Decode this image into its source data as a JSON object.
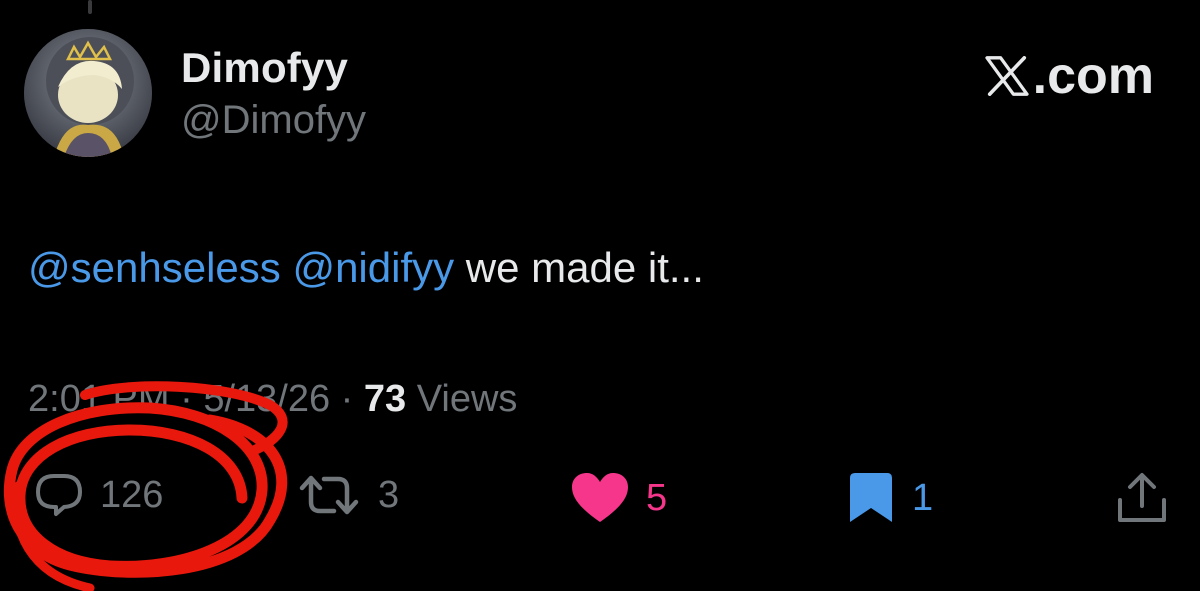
{
  "author": {
    "display_name": "Dimofyy",
    "handle": "@Dimofyy",
    "avatar_icon": "avatar-image"
  },
  "brand": {
    "label": ".com",
    "logo_icon": "x-logo-icon"
  },
  "tweet": {
    "mentions": [
      "@senhseless",
      "@nidifyy"
    ],
    "body": "we made it..."
  },
  "meta": {
    "time": "2:01 PM",
    "separator": "·",
    "date": "5/13/26",
    "views_count": "73",
    "views_label": "Views"
  },
  "actions": {
    "replies": "126",
    "reposts": "3",
    "likes": "5",
    "bookmarks": "1"
  },
  "colors": {
    "background": "#000000",
    "text": "#e7e9ea",
    "muted": "#71767b",
    "mention": "#4a99e9",
    "like": "#f5368b",
    "bookmark": "#4a99e9",
    "annotation": "#e8180c"
  },
  "annotation": {
    "shape": "hand-drawn red circle around reply count"
  }
}
